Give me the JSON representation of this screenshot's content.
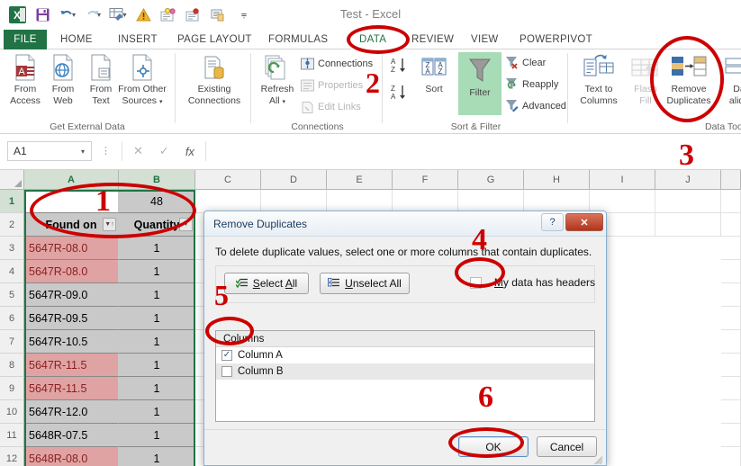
{
  "window": {
    "title": "Test - Excel"
  },
  "quick_access": {
    "items": [
      {
        "name": "excel-logo",
        "label": ""
      },
      {
        "name": "save-icon",
        "label": ""
      },
      {
        "name": "undo-icon",
        "label": ""
      },
      {
        "name": "redo-icon",
        "label": ""
      },
      {
        "name": "format-painter-icon",
        "label": ""
      },
      {
        "name": "warning-icon",
        "label": ""
      },
      {
        "name": "new-comment-icon",
        "label": ""
      },
      {
        "name": "record-icon",
        "label": ""
      },
      {
        "name": "copy-sheet-icon",
        "label": ""
      },
      {
        "name": "customize-qat-icon",
        "label": ""
      }
    ]
  },
  "ribbon": {
    "tabs": [
      {
        "label": "FILE",
        "active": false
      },
      {
        "label": "HOME",
        "active": false
      },
      {
        "label": "INSERT",
        "active": false
      },
      {
        "label": "PAGE LAYOUT",
        "active": false
      },
      {
        "label": "FORMULAS",
        "active": false
      },
      {
        "label": "DATA",
        "active": true
      },
      {
        "label": "REVIEW",
        "active": false
      },
      {
        "label": "VIEW",
        "active": false
      },
      {
        "label": "POWERPIVOT",
        "active": false
      }
    ],
    "groups": [
      {
        "name": "get-external-data",
        "label": "Get External Data",
        "buttons": [
          {
            "label_line1": "From",
            "label_line2": "Access",
            "icon": "from-access-icon"
          },
          {
            "label_line1": "From",
            "label_line2": "Web",
            "icon": "from-web-icon"
          },
          {
            "label_line1": "From",
            "label_line2": "Text",
            "icon": "from-text-icon"
          },
          {
            "label_line1": "From Other",
            "label_line2": "Sources",
            "icon": "from-other-sources-icon"
          },
          {
            "label_line1": "Existing",
            "label_line2": "Connections",
            "icon": "existing-connections-icon"
          }
        ]
      },
      {
        "name": "connections",
        "label": "Connections",
        "big": {
          "label_line1": "Refresh",
          "label_line2": "All",
          "icon": "refresh-all-icon"
        },
        "small": [
          {
            "label": "Connections",
            "icon": "connections-icon",
            "disabled": false
          },
          {
            "label": "Properties",
            "icon": "properties-icon",
            "disabled": true
          },
          {
            "label": "Edit Links",
            "icon": "edit-links-icon",
            "disabled": true
          }
        ]
      },
      {
        "name": "sort-filter",
        "label": "Sort & Filter",
        "sort_az": "A↓",
        "sort_za": "Z↓",
        "sort_label": "Sort",
        "filter_label": "Filter",
        "small": [
          {
            "label": "Clear",
            "icon": "clear-filter-icon"
          },
          {
            "label": "Reapply",
            "icon": "reapply-filter-icon"
          },
          {
            "label": "Advanced",
            "icon": "advanced-filter-icon"
          }
        ]
      },
      {
        "name": "data-tools",
        "label": "Data Tools",
        "buttons": [
          {
            "label_line1": "Text to",
            "label_line2": "Columns",
            "icon": "text-to-columns-icon",
            "disabled": false
          },
          {
            "label_line1": "Flash",
            "label_line2": "Fill",
            "icon": "flash-fill-icon",
            "disabled": true
          },
          {
            "label_line1": "Remove",
            "label_line2": "Duplicates",
            "icon": "remove-duplicates-icon",
            "disabled": false
          },
          {
            "label_line1": "Da",
            "label_line2": "alida",
            "icon": "data-validation-icon",
            "disabled": false
          }
        ]
      }
    ]
  },
  "formula_bar": {
    "name_box_value": "A1",
    "cancel_icon": "✕",
    "enter_icon": "✓",
    "function_icon": "fx",
    "formula_value": ""
  },
  "sheet": {
    "column_headers": [
      "A",
      "B",
      "C",
      "D",
      "E",
      "F",
      "G",
      "H",
      "I",
      "J"
    ],
    "row_headers": [
      "1",
      "2",
      "3",
      "4",
      "5",
      "6",
      "7",
      "8",
      "9",
      "10",
      "11",
      "12"
    ],
    "rows": [
      {
        "row": "1",
        "a": "",
        "b": "48",
        "style": "shade-b",
        "selected": true
      },
      {
        "row": "2",
        "a": "Found on",
        "b": "Quantity",
        "style": "header-row"
      },
      {
        "row": "3",
        "a": "5647R-08.0",
        "b": "1",
        "style": "dup"
      },
      {
        "row": "4",
        "a": "5647R-08.0",
        "b": "1",
        "style": "dup"
      },
      {
        "row": "5",
        "a": "5647R-09.0",
        "b": "1",
        "style": "shade"
      },
      {
        "row": "6",
        "a": "5647R-09.5",
        "b": "1",
        "style": "shade"
      },
      {
        "row": "7",
        "a": "5647R-10.5",
        "b": "1",
        "style": "shade"
      },
      {
        "row": "8",
        "a": "5647R-11.5",
        "b": "1",
        "style": "dup"
      },
      {
        "row": "9",
        "a": "5647R-11.5",
        "b": "1",
        "style": "dup"
      },
      {
        "row": "10",
        "a": "5647R-12.0",
        "b": "1",
        "style": "shade"
      },
      {
        "row": "11",
        "a": "5648R-07.5",
        "b": "1",
        "style": "shade"
      },
      {
        "row": "12",
        "a": "5648R-08.0",
        "b": "1",
        "style": "dup"
      }
    ]
  },
  "dialog": {
    "title": "Remove Duplicates",
    "help_icon": "?",
    "close_icon": "✕",
    "instruction": "To delete duplicate values, select one or more columns that contain duplicates.",
    "select_all_label": "Select All",
    "unselect_all_label": "Unselect All",
    "my_data_has_headers_label": "My data has headers",
    "my_data_has_headers_checked": false,
    "columns_header": "Columns",
    "columns": [
      {
        "label": "Column A",
        "checked": true
      },
      {
        "label": "Column B",
        "checked": false
      }
    ],
    "ok_label": "OK",
    "cancel_label": "Cancel"
  },
  "annotations": {
    "markers": [
      {
        "number": "1",
        "target": "selected-cells-a1-b1"
      },
      {
        "number": "2",
        "target": "data-tab"
      },
      {
        "number": "3",
        "target": "remove-duplicates-button"
      },
      {
        "number": "4",
        "target": "my-data-has-headers-checkbox"
      },
      {
        "number": "5",
        "target": "column-a-checkbox"
      },
      {
        "number": "6",
        "target": "ok-button"
      }
    ],
    "color": "#cc0000"
  }
}
